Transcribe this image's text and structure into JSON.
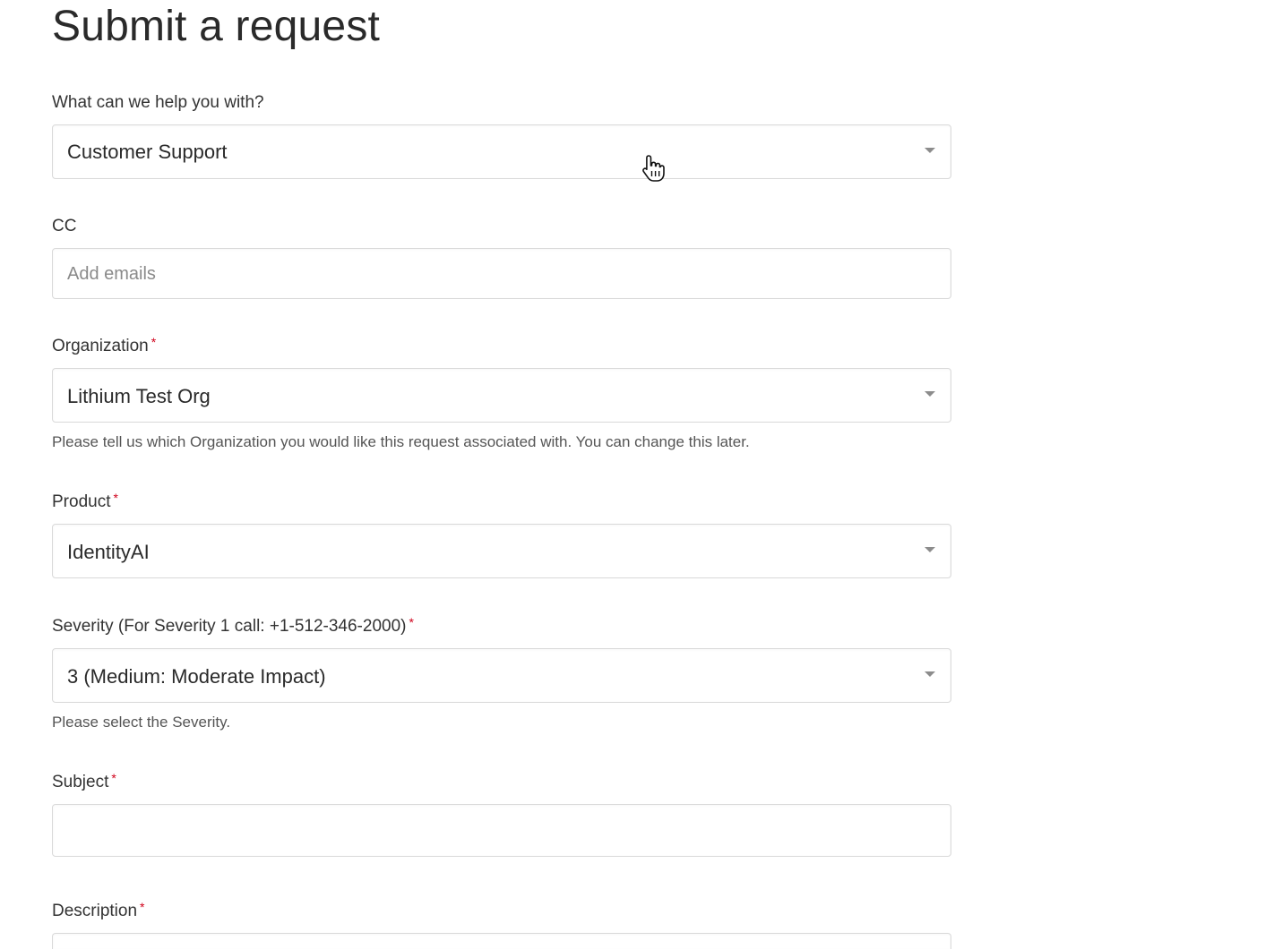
{
  "page": {
    "title": "Submit a request"
  },
  "form": {
    "help_with": {
      "label": "What can we help you with?",
      "value": "Customer Support"
    },
    "cc": {
      "label": "CC",
      "placeholder": "Add emails"
    },
    "organization": {
      "label": "Organization",
      "required_mark": "*",
      "value": "Lithium Test Org",
      "hint": "Please tell us which Organization you would like this request associated with. You can change this later."
    },
    "product": {
      "label": "Product",
      "required_mark": "*",
      "value": "IdentityAI"
    },
    "severity": {
      "label": "Severity (For Severity 1 call: +1-512-346-2000)",
      "required_mark": "*",
      "value": "3 (Medium: Moderate Impact)",
      "hint": "Please select the Severity."
    },
    "subject": {
      "label": "Subject",
      "required_mark": "*",
      "value": ""
    },
    "description": {
      "label": "Description",
      "required_mark": "*"
    }
  },
  "icons": {
    "dropdown": "chevron-down-icon",
    "cursor": "hand-pointer-cursor"
  },
  "colors": {
    "required": "#d0021b",
    "border": "#d9d9d9",
    "text": "#333333"
  }
}
